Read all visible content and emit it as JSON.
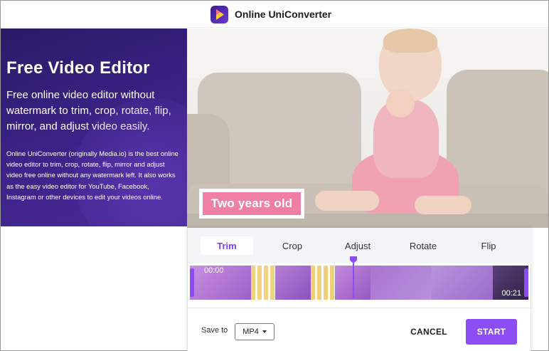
{
  "header": {
    "brand_name": "Online UniConverter",
    "logo_icon": "uniconverter-logo-icon"
  },
  "hero": {
    "title": "Free Video Editor",
    "subtitle": "Free online video editor without watermark to trim, crop, rotate, flip, mirror, and adjust video easily.",
    "description": "Online UniConverter (originally Media.io) is the best online video editor to trim, crop, rotate, flip, mirror and adjust video free online without any watermark left. It also works as the easy video editor for YouTube, Facebook, Instagram or other devices to edit your videos online."
  },
  "preview": {
    "caption": "Two years old"
  },
  "editor": {
    "tabs": [
      {
        "label": "Trim",
        "active": true
      },
      {
        "label": "Crop",
        "active": false
      },
      {
        "label": "Adjust",
        "active": false
      },
      {
        "label": "Rotate",
        "active": false
      },
      {
        "label": "Flip",
        "active": false
      }
    ],
    "timeline": {
      "start_time": "00:00",
      "end_time": "00:21"
    },
    "save_to_label": "Save to",
    "format": "MP4",
    "cancel_label": "CANCEL",
    "start_label": "START"
  },
  "colors": {
    "accent": "#8c4df5",
    "hero_bg": "#3a2183",
    "caption_bg": "#f07fa6"
  }
}
